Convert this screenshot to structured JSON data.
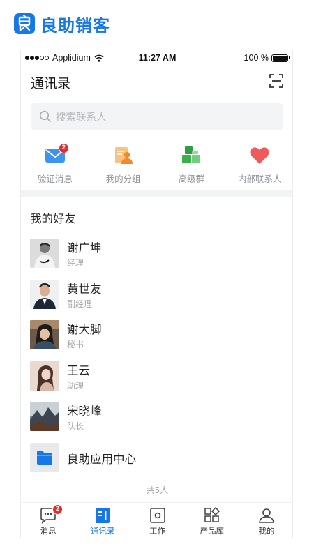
{
  "brand": {
    "name": "良助销客"
  },
  "status_bar": {
    "carrier": "Applidium",
    "time": "11:27 AM",
    "battery_text": "100 %",
    "battery_level": 1.0
  },
  "header": {
    "title": "通讯录"
  },
  "search": {
    "placeholder": "搜索联系人"
  },
  "quick_actions": [
    {
      "label": "验证消息",
      "icon": "mail-icon",
      "badge": "2",
      "color": "#3d93f0"
    },
    {
      "label": "我的分组",
      "icon": "group-icon",
      "color": "#f5a54a"
    },
    {
      "label": "高级群",
      "icon": "advanced-group-icon",
      "color": "#35b34a"
    },
    {
      "label": "内部联系人",
      "icon": "heart-icon",
      "color": "#f05a5a"
    }
  ],
  "friends_section": {
    "title": "我的好友"
  },
  "friends": [
    {
      "name": "谢广坤",
      "role": "经理"
    },
    {
      "name": "黄世友",
      "role": "副经理"
    },
    {
      "name": "谢大脚",
      "role": "秘书"
    },
    {
      "name": "王云",
      "role": "助理"
    },
    {
      "name": "宋晓峰",
      "role": "队长"
    }
  ],
  "app_center": {
    "label": "良助应用中心",
    "icon": "folder-icon"
  },
  "footer": {
    "count_text": "共5人"
  },
  "tabs": [
    {
      "label": "消息",
      "icon": "message-icon",
      "badge": "2",
      "active": false
    },
    {
      "label": "通讯录",
      "icon": "contacts-icon",
      "active": true
    },
    {
      "label": "工作",
      "icon": "work-icon",
      "active": false
    },
    {
      "label": "产品库",
      "icon": "product-icon",
      "active": false
    },
    {
      "label": "我的",
      "icon": "profile-icon",
      "active": false
    }
  ],
  "colors": {
    "accent": "#1677e6",
    "badge": "#e62b2b",
    "divider": "#f2f3f5"
  }
}
